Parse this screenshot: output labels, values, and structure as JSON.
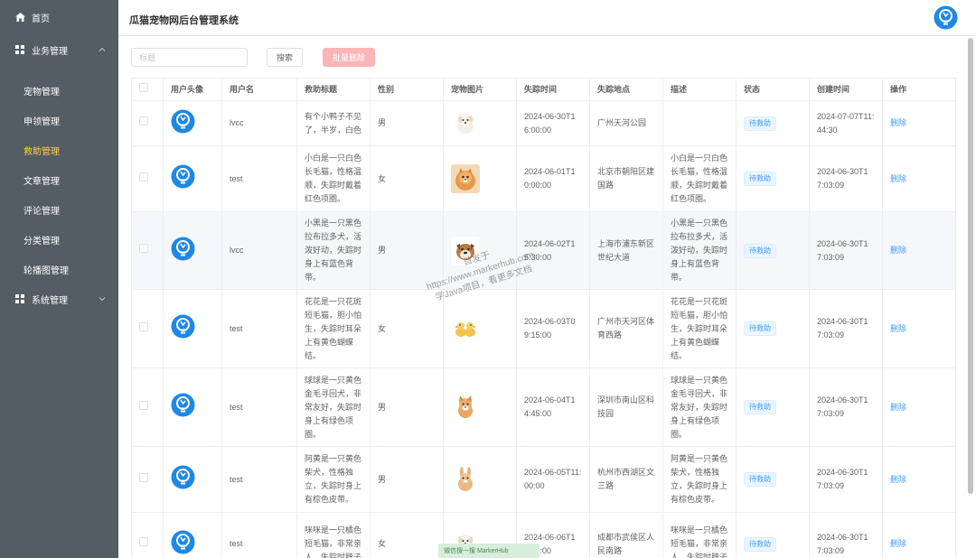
{
  "app": {
    "title": "瓜猫宠物网后台管理系统"
  },
  "sidebar": {
    "home": "首页",
    "business_group": "业务管理",
    "items": [
      "宠物管理",
      "申领管理",
      "救助管理",
      "文章管理",
      "评论管理",
      "分类管理",
      "轮播图管理"
    ],
    "active_item": "救助管理",
    "system_group": "系统管理"
  },
  "toolbar": {
    "search_placeholder": "标题",
    "search_label": "搜索",
    "batch_delete_label": "批量删除"
  },
  "table": {
    "columns": [
      "用户头像",
      "用户名",
      "救助标题",
      "性别",
      "宠物图片",
      "失踪时间",
      "失踪地点",
      "描述",
      "状态",
      "创建时间",
      "操作"
    ],
    "rows": [
      {
        "username": "lvcc",
        "title": "有个小鸭子不见了，半岁，白色",
        "gender": "男",
        "pet_icon": "white-puppy-icon",
        "lost_time": "2024-06-30T16:00:00",
        "location": "广州天河公园",
        "desc": "",
        "status": "待救助",
        "created": "2024-07-07T11:44:30",
        "action": "删除"
      },
      {
        "username": "test",
        "title": "小白是一只白色长毛猫，性格温顺，失踪时戴着红色项圈。",
        "gender": "女",
        "pet_icon": "pomeranian-icon",
        "lost_time": "2024-06-01T10:00:00",
        "location": "北京市朝阳区建国路",
        "desc": "小白是一只白色长毛猫，性格温顺，失踪时戴着红色项圈。",
        "status": "待救助",
        "created": "2024-06-30T17:03:09",
        "action": "删除"
      },
      {
        "username": "lvcc",
        "title": "小黑是一只黑色拉布拉多犬，活泼好动，失踪时身上有蓝色背带。",
        "gender": "男",
        "pet_icon": "bulldog-icon",
        "lost_time": "2024-06-02T15:30:00",
        "location": "上海市浦东新区世纪大道",
        "desc": "小黑是一只黑色拉布拉多犬，活泼好动，失踪时身上有蓝色背带。",
        "status": "待救助",
        "created": "2024-06-30T17:03:09",
        "action": "删除"
      },
      {
        "username": "test",
        "title": "花花是一只花斑短毛猫，胆小怕生，失踪时耳朵上有黄色蝴蝶结。",
        "gender": "女",
        "pet_icon": "ducklings-icon",
        "lost_time": "2024-06-03T09:15:00",
        "location": "广州市天河区体育西路",
        "desc": "花花是一只花斑短毛猫，胆小怕生，失踪时耳朵上有黄色蝴蝶结。",
        "status": "待救助",
        "created": "2024-06-30T17:03:09",
        "action": "删除"
      },
      {
        "username": "test",
        "title": "球球是一只黄色金毛寻回犬，非常友好，失踪时身上有绿色项圈。",
        "gender": "男",
        "pet_icon": "corgi-icon",
        "lost_time": "2024-06-04T14:45:00",
        "location": "深圳市南山区科技园",
        "desc": "球球是一只黄色金毛寻回犬，非常友好，失踪时身上有绿色项圈。",
        "status": "待救助",
        "created": "2024-06-30T17:03:09",
        "action": "删除"
      },
      {
        "username": "test",
        "title": "阿黄是一只黄色柴犬，性格独立，失踪时身上有棕色皮带。",
        "gender": "男",
        "pet_icon": "rabbit-icon",
        "lost_time": "2024-06-05T11:00:00",
        "location": "杭州市西湖区文三路",
        "desc": "阿黄是一只黄色柴犬，性格独立，失踪时身上有棕色皮带。",
        "status": "待救助",
        "created": "2024-06-30T17:03:09",
        "action": "删除"
      },
      {
        "username": "test",
        "title": "咪咪是一只橘色短毛猫，非常亲人，失踪时脖子",
        "gender": "女",
        "pet_icon": "white-puppy-icon",
        "lost_time": "2024-06-06T16:00:00",
        "location": "成都市武侯区人民南路",
        "desc": "咪咪是一只橘色短毛猫，非常亲人，失踪时脖子",
        "status": "待救助",
        "created": "2024-06-30T17:03:09",
        "action": "删除"
      }
    ]
  },
  "watermark": {
    "line1": "首发于",
    "line2": "https://www.markerhub.com",
    "line3": "学Java项目，看更多文档",
    "badge": "微信搜一搜 MarkerHub"
  },
  "colors": {
    "sidebar_bg": "#545c64",
    "active_menu": "#ffd04b",
    "primary": "#409eff",
    "danger_light": "#fab6b6",
    "avatar_blue": "#1e88e5"
  }
}
